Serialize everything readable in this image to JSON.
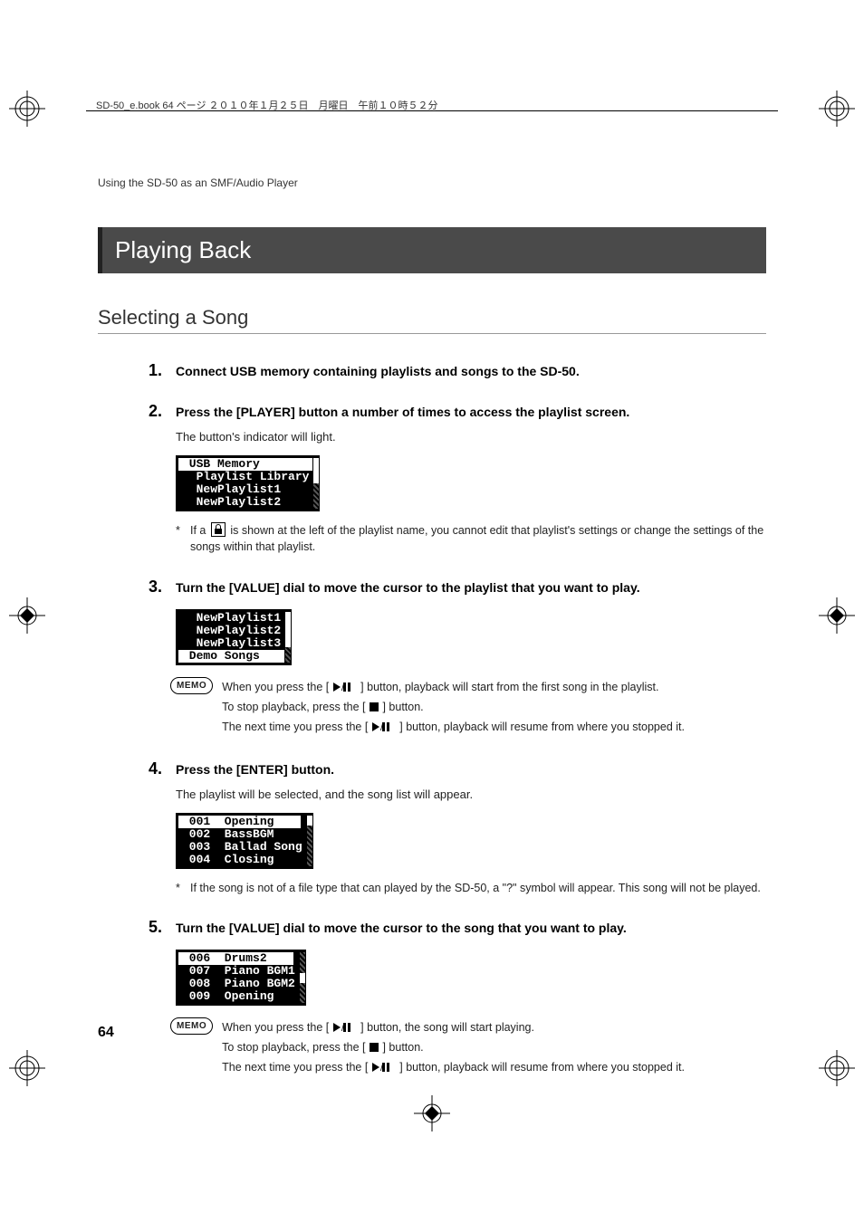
{
  "header_line": "SD-50_e.book  64 ページ  ２０１０年１月２５日　月曜日　午前１０時５２分",
  "breadcrumb": "Using the SD-50 as an SMF/Audio Player",
  "h1": "Playing Back",
  "h2": "Selecting a Song",
  "memo_label": "MEMO",
  "page_number": "64",
  "steps": {
    "s1": {
      "num": "1.",
      "title": "Connect USB memory containing playlists and songs to the SD-50."
    },
    "s2": {
      "num": "2.",
      "title": "Press the [PLAYER] button a number of times to access the playlist screen.",
      "body": "The button's indicator will light.",
      "lcd": {
        "l1": " USB Memory",
        "l2": "  Playlist Library",
        "l3": "  NewPlaylist1",
        "l4": "  NewPlaylist2"
      },
      "note_pre": "If a ",
      "note_post": " is shown at the left of the playlist name, you cannot edit that playlist's settings or change the settings of the songs within that playlist."
    },
    "s3": {
      "num": "3.",
      "title": "Turn the [VALUE] dial to move the cursor to the playlist that you want to play.",
      "lcd": {
        "l1": "  NewPlaylist1",
        "l2": "  NewPlaylist2",
        "l3": "  NewPlaylist3",
        "l4": " Demo Songs"
      },
      "memo": {
        "m1a": "When you press the [ ",
        "m1b": " ] button, playback will start from the first song in the playlist.",
        "m2a": "To stop playback, press the [ ",
        "m2b": " ] button.",
        "m3a": "The next time you press the [ ",
        "m3b": " ] button, playback will resume from where you stopped it."
      }
    },
    "s4": {
      "num": "4.",
      "title": "Press the [ENTER] button.",
      "body": "The playlist will be selected, and the song list will appear.",
      "lcd": {
        "l1": " 001  Opening",
        "l2": " 002  BassBGM",
        "l3": " 003  Ballad Song",
        "l4": " 004  Closing"
      },
      "note": "If the song is not of a file type that can played by the SD-50, a \"?\" symbol will appear. This song will not be played."
    },
    "s5": {
      "num": "5.",
      "title": "Turn the [VALUE] dial to move the cursor to the song that you want to play.",
      "lcd": {
        "l1": " 006  Drums2",
        "l2": " 007  Piano BGM1",
        "l3": " 008  Piano BGM2",
        "l4": " 009  Opening"
      },
      "memo": {
        "m1a": "When you press the [ ",
        "m1b": " ] button, the song will start playing.",
        "m2a": "To stop playback, press the [ ",
        "m2b": " ] button.",
        "m3a": "The next time you press the [ ",
        "m3b": " ] button, playback will resume from where you stopped it."
      }
    }
  }
}
